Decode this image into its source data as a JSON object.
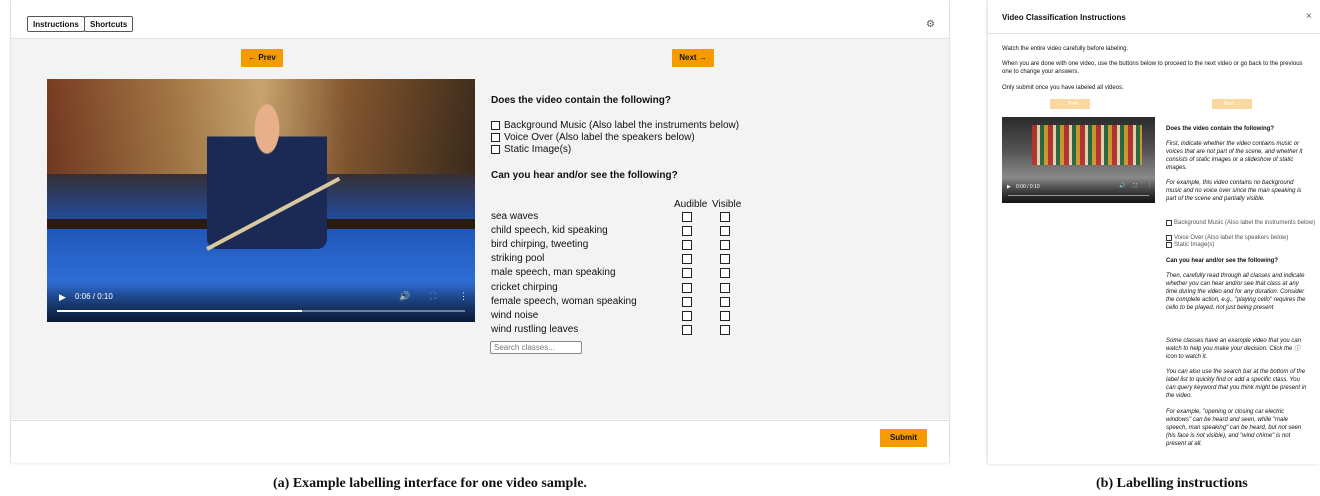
{
  "panel_a": {
    "toolbar": {
      "instructions": "Instructions",
      "shortcuts": "Shortcuts",
      "settings_icon": "gear-icon"
    },
    "nav": {
      "prev": "← Prev",
      "next": "Next →"
    },
    "video": {
      "time": "0:06 / 0:10",
      "progress": 0.6
    },
    "question1": "Does the video contain the following?",
    "options": [
      "Background Music (Also label the instruments below)",
      "Voice Over (Also label the speakers below)",
      "Static Image(s)"
    ],
    "question2": "Can you hear and/or see the following?",
    "columns": {
      "audible": "Audible",
      "visible": "Visible"
    },
    "classes": [
      "sea waves",
      "child speech, kid speaking",
      "bird chirping, tweeting",
      "striking pool",
      "male speech, man speaking",
      "cricket chirping",
      "female speech, woman speaking",
      "wind noise",
      "wind rustling leaves"
    ],
    "search_placeholder": "Search classes...",
    "submit": "Submit",
    "caption": "(a) Example labelling interface for one video sample."
  },
  "panel_b": {
    "title": "Video Classification Instructions",
    "close": "×",
    "p1": "Watch the entire video carefully before labeling.",
    "p2": "When you are done with one video, use the buttons below to proceed to the next video or go back to the previous one to change your answers.",
    "p3": "Only submit once you have labeled all videos.",
    "prev": "← Prev",
    "next": "Next →",
    "video": {
      "time": "0:00 / 0:10",
      "progress": 0.0
    },
    "q1": "Does the video contain the following?",
    "i1": "First, indicate whether the video contains music or voices that are not part of the scene, and whether it consists of static images or a slideshow of static images.",
    "i2": "For example, this video contains no background music and no voice over since the man speaking is part of the scene and partially visible.",
    "options": [
      "Background Music (Also label the instruments below)",
      "Voice Over (Also label the speakers below)",
      "Static Image(s)"
    ],
    "q2": "Can you hear and/or see the following?",
    "i3": "Then, carefully read through all classes and indicate whether you can hear and/or see that class at any time during the video and for any duration. Consider the complete action, e.g., \"playing cello\" requires the cello to be played, not just being present",
    "i4": "Some classes have an example video that you can watch to help you make your decision. Click the ⓘ icon to watch it.",
    "i5": "You can also use the search bar at the bottom of the label list to quickly find or add a specific class. You can query keyword that you think might be present in the video.",
    "i6": "For example, \"opening or closing car electric windows\" can be heard and seen, while \"male speech, man speaking\" can be heard, but not seen (his face is not visible), and \"wind chime\" is not present at all.",
    "caption": "(b) Labelling instructions"
  }
}
